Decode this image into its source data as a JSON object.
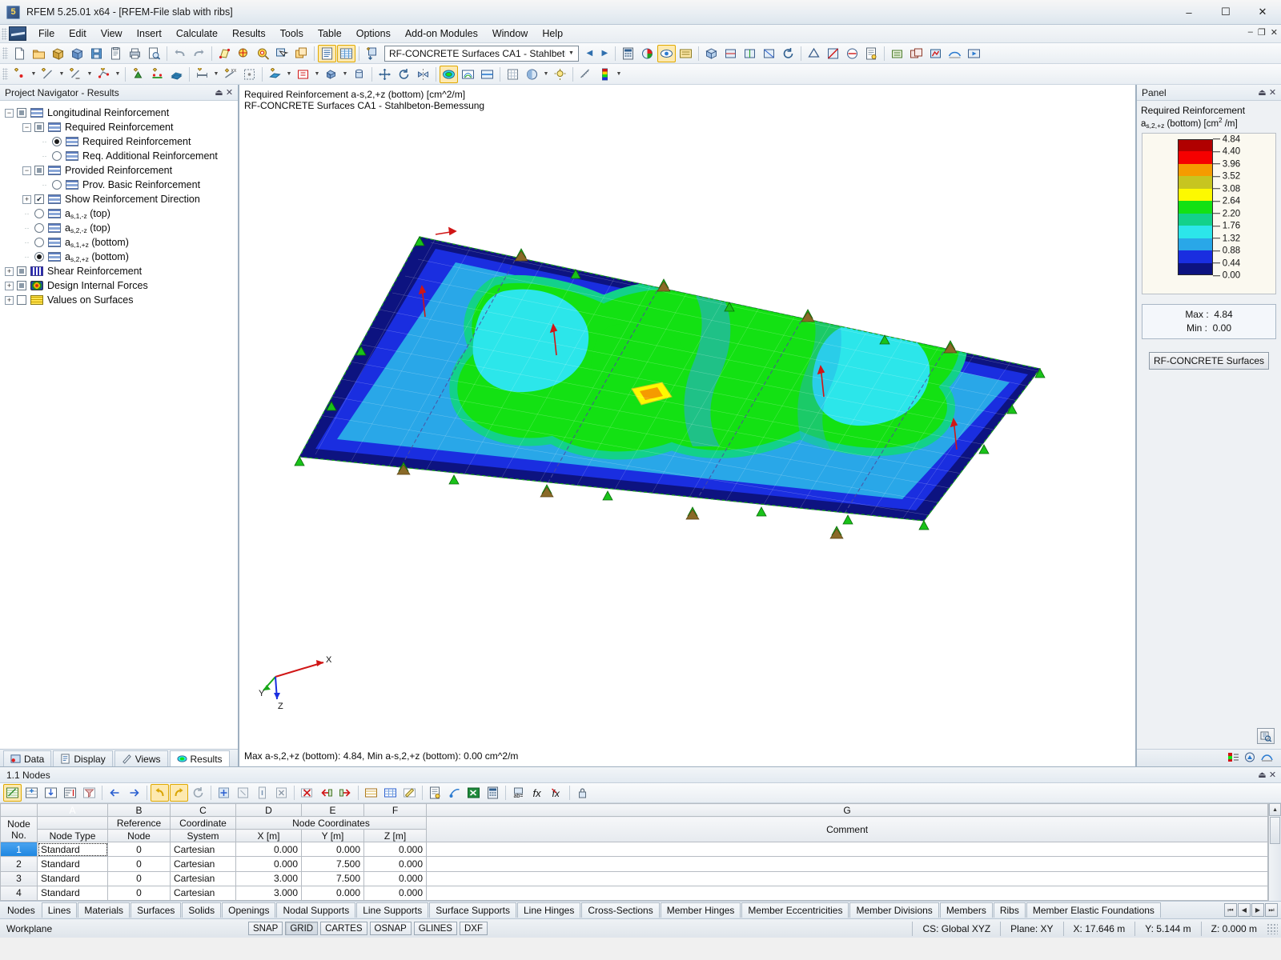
{
  "window": {
    "title": "RFEM 5.25.01 x64 - [RFEM-File slab with ribs]",
    "minimize": "–",
    "maximize": "☐",
    "close": "✕",
    "sub_minimize": "–",
    "sub_restore": "❐",
    "sub_close": "✕"
  },
  "menu": {
    "items": [
      "File",
      "Edit",
      "View",
      "Insert",
      "Calculate",
      "Results",
      "Tools",
      "Table",
      "Options",
      "Add-on Modules",
      "Window",
      "Help"
    ]
  },
  "toolbar": {
    "module_combo": "RF-CONCRETE Surfaces CA1 - Stahlbet",
    "combo_arrow": "▼",
    "prev_arrow": "◀",
    "next_arrow": "▶"
  },
  "navigator": {
    "header": "Project Navigator - Results",
    "pin": "⏏",
    "close": "✕",
    "tree": [
      {
        "label": "Longitudinal Reinforcement",
        "indent": 0,
        "expander": "−",
        "control": "square",
        "glyph": "bars"
      },
      {
        "label": "Required Reinforcement",
        "indent": 1,
        "expander": "−",
        "control": "square",
        "glyph": "bars"
      },
      {
        "label": "Required Reinforcement",
        "indent": 2,
        "expander": "",
        "control": "radio-on",
        "glyph": "bars"
      },
      {
        "label": "Req. Additional Reinforcement",
        "indent": 2,
        "expander": "",
        "control": "radio-off",
        "glyph": "bars"
      },
      {
        "label": "Provided Reinforcement",
        "indent": 1,
        "expander": "−",
        "control": "square",
        "glyph": "bars"
      },
      {
        "label": "Prov. Basic Reinforcement",
        "indent": 2,
        "expander": "",
        "control": "radio-off",
        "glyph": "bars"
      },
      {
        "label": "Show Reinforcement Direction",
        "indent": 1,
        "expander": "+",
        "control": "check",
        "glyph": "bars"
      },
      {
        "label": "a_s,1,-z (top)",
        "indent": 1,
        "expander": "",
        "control": "radio-off",
        "glyph": "bars",
        "rich": true,
        "rich_parts": {
          "base": "a",
          "sub": "s,1,-z",
          "tail": " (top)"
        }
      },
      {
        "label": "a_s,2,-z (top)",
        "indent": 1,
        "expander": "",
        "control": "radio-off",
        "glyph": "bars",
        "rich": true,
        "rich_parts": {
          "base": "a",
          "sub": "s,2,-z",
          "tail": " (top)"
        }
      },
      {
        "label": "a_s,1,+z (bottom)",
        "indent": 1,
        "expander": "",
        "control": "radio-off",
        "glyph": "bars",
        "rich": true,
        "rich_parts": {
          "base": "a",
          "sub": "s,1,+z",
          "tail": " (bottom)"
        }
      },
      {
        "label": "a_s,2,+z (bottom)",
        "indent": 1,
        "expander": "",
        "control": "radio-on",
        "glyph": "bars",
        "rich": true,
        "rich_parts": {
          "base": "a",
          "sub": "s,2,+z",
          "tail": " (bottom)"
        }
      },
      {
        "label": "Shear Reinforcement",
        "indent": 0,
        "expander": "+",
        "control": "square",
        "glyph": "shear"
      },
      {
        "label": "Design Internal Forces",
        "indent": 0,
        "expander": "+",
        "control": "square",
        "glyph": "dif"
      },
      {
        "label": "Values on Surfaces",
        "indent": 0,
        "expander": "+",
        "control": "empty",
        "glyph": "vos"
      }
    ],
    "tabs": [
      {
        "label": "Data",
        "icon": "data-icon",
        "selected": false
      },
      {
        "label": "Display",
        "icon": "display-icon",
        "selected": false
      },
      {
        "label": "Views",
        "icon": "views-icon",
        "selected": false
      },
      {
        "label": "Results",
        "icon": "results-icon",
        "selected": true
      }
    ]
  },
  "view": {
    "title_line1": "Required Reinforcement a-s,2,+z (bottom) [cm^2/m]",
    "title_line2": "RF-CONCRETE Surfaces CA1 - Stahlbeton-Bemessung",
    "footer": "Max a-s,2,+z (bottom): 4.84, Min a-s,2,+z (bottom): 0.00 cm^2/m",
    "axis_x": "X",
    "axis_y": "Y",
    "axis_z": "Z"
  },
  "panel": {
    "header": "Panel",
    "pin": "⏏",
    "close": "✕",
    "title": "Required Reinforcement",
    "quantity_base": "a",
    "quantity_sub": "s,2,+z",
    "quantity_tail": " (bottom) [cm",
    "quantity_sup": "2",
    "quantity_tail2": " /m]",
    "legend_labels": [
      "4.84",
      "4.40",
      "3.96",
      "3.52",
      "3.08",
      "2.64",
      "2.20",
      "1.76",
      "1.32",
      "0.88",
      "0.44",
      "0.00"
    ],
    "legend_colors": [
      "#b00000",
      "#f50000",
      "#f59b00",
      "#c7c520",
      "#fdf900",
      "#13e113",
      "#13d18a",
      "#2ce6ea",
      "#29a7e8",
      "#1a2ee0",
      "#0d1380"
    ],
    "max_label": "Max  :",
    "max_value": "4.84",
    "min_label": "Min   :",
    "min_value": "0.00",
    "button": "RF-CONCRETE Surfaces",
    "zoom_icon": "magnifier-icon"
  },
  "table": {
    "header": "1.1 Nodes",
    "pin": "⏏",
    "close": "✕",
    "column_letters": [
      "A",
      "B",
      "C",
      "D",
      "E",
      "F",
      "G"
    ],
    "group_header": "Node Coordinates",
    "headers_top": [
      "Node",
      "Reference",
      "Coordinate"
    ],
    "headers": {
      "node_no_1": "Node",
      "node_no_2": "No.",
      "node_type": "Node Type",
      "reference_1": "Reference",
      "reference_2": "Node",
      "coordsys_1": "Coordinate",
      "coordsys_2": "System",
      "x": "X [m]",
      "y": "Y [m]",
      "z": "Z [m]",
      "comment": "Comment"
    },
    "rows": [
      {
        "no": "1",
        "type": "Standard",
        "ref": "0",
        "cs": "Cartesian",
        "x": "0.000",
        "y": "0.000",
        "z": "0.000",
        "comment": ""
      },
      {
        "no": "2",
        "type": "Standard",
        "ref": "0",
        "cs": "Cartesian",
        "x": "0.000",
        "y": "7.500",
        "z": "0.000",
        "comment": ""
      },
      {
        "no": "3",
        "type": "Standard",
        "ref": "0",
        "cs": "Cartesian",
        "x": "3.000",
        "y": "7.500",
        "z": "0.000",
        "comment": ""
      },
      {
        "no": "4",
        "type": "Standard",
        "ref": "0",
        "cs": "Cartesian",
        "x": "3.000",
        "y": "0.000",
        "z": "0.000",
        "comment": ""
      }
    ],
    "tabs": [
      "Nodes",
      "Lines",
      "Materials",
      "Surfaces",
      "Solids",
      "Openings",
      "Nodal Supports",
      "Line Supports",
      "Surface Supports",
      "Line Hinges",
      "Cross-Sections",
      "Member Hinges",
      "Member Eccentricities",
      "Member Divisions",
      "Members",
      "Ribs",
      "Member Elastic Foundations"
    ],
    "tab_nav": [
      "⏮",
      "◀",
      "▶",
      "⏭"
    ]
  },
  "statusbar": {
    "workplane": "Workplane",
    "toggles": [
      {
        "label": "SNAP",
        "on": false
      },
      {
        "label": "GRID",
        "on": true
      },
      {
        "label": "CARTES",
        "on": false
      },
      {
        "label": "OSNAP",
        "on": false
      },
      {
        "label": "GLINES",
        "on": false
      },
      {
        "label": "DXF",
        "on": false
      }
    ],
    "cs": "CS: Global XYZ",
    "plane": "Plane: XY",
    "x": "X:  17.646 m",
    "y": "Y:  5.144 m",
    "z": "Z:  0.000 m"
  },
  "chart_data": {
    "type": "heatmap",
    "title": "Required Reinforcement a-s,2,+z (bottom) [cm^2/m]",
    "subtitle": "RF-CONCRETE Surfaces CA1 - Stahlbeton-Bemessung",
    "unit": "cm^2/m",
    "contour_levels": [
      0.0,
      0.44,
      0.88,
      1.32,
      1.76,
      2.2,
      2.64,
      3.08,
      3.52,
      3.96,
      4.4,
      4.84
    ],
    "level_colors": [
      "#0d1380",
      "#1a2ee0",
      "#29a7e8",
      "#2ce6ea",
      "#13d18a",
      "#13e113",
      "#fdf900",
      "#c7c520",
      "#f59b00",
      "#f50000",
      "#b00000"
    ],
    "max": 4.84,
    "min": 0.0,
    "model": "slab with ribs",
    "legend_position": "right-panel"
  }
}
